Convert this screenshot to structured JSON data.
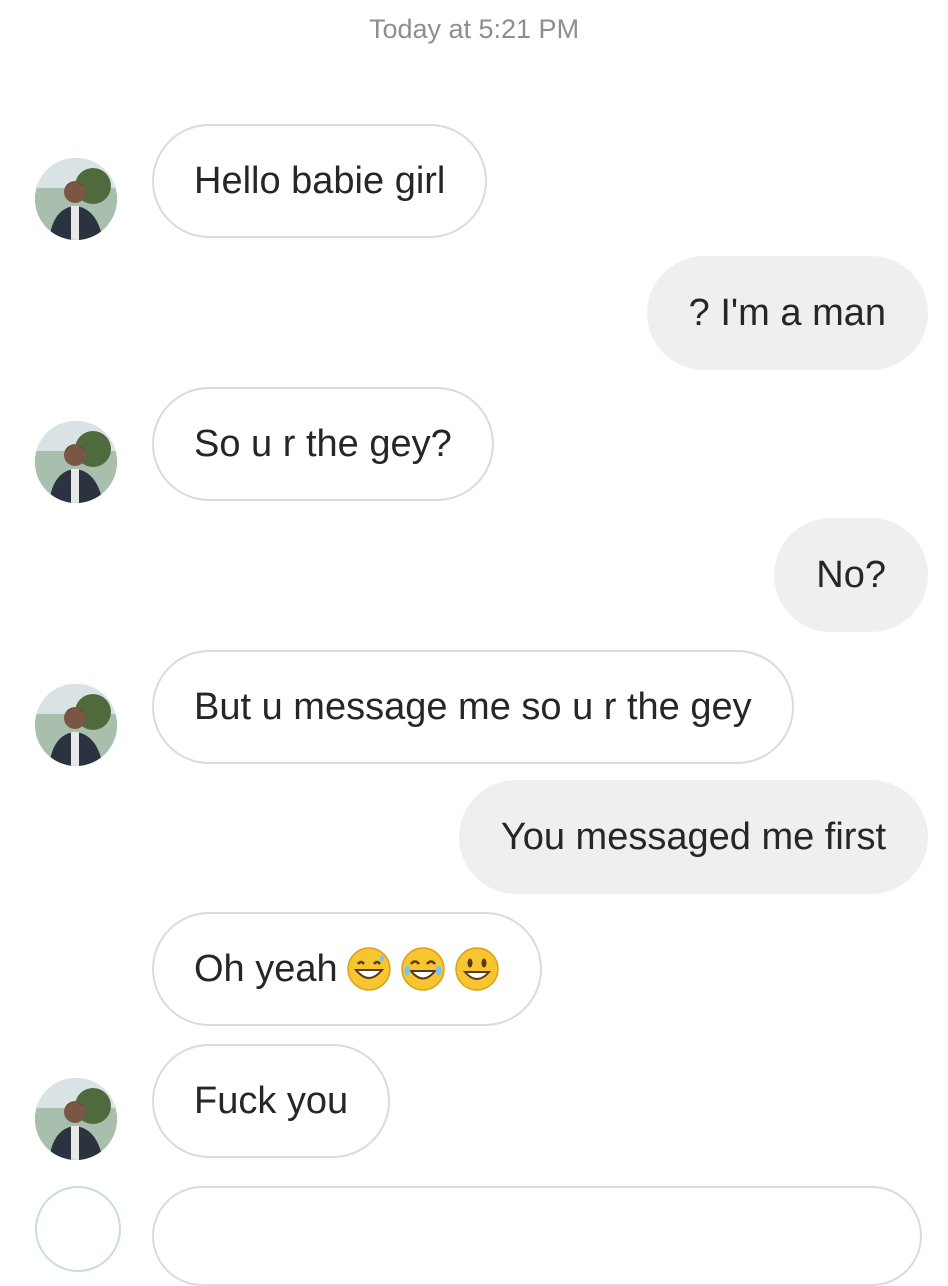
{
  "header": {
    "timestamp": "Today at 5:21 PM"
  },
  "messages": [
    {
      "side": "in",
      "text": "Hello babie girl"
    },
    {
      "side": "out",
      "text": "? I'm a man"
    },
    {
      "side": "in",
      "text": "So u r the gey?"
    },
    {
      "side": "out",
      "text": "No?"
    },
    {
      "side": "in",
      "text": "But u message me so u r the gey"
    },
    {
      "side": "out",
      "text": "You messaged me first"
    },
    {
      "side": "in",
      "text": "Oh yeah",
      "emojis": [
        "grinning-sweat-emoji",
        "tears-of-joy-emoji",
        "smiley-emoji"
      ]
    },
    {
      "side": "in",
      "text": "Fuck you"
    }
  ],
  "colors": {
    "incoming_border": "#dbdbdb",
    "outgoing_bg": "#efefef",
    "timestamp": "#8e8e8e",
    "text": "#262626"
  }
}
